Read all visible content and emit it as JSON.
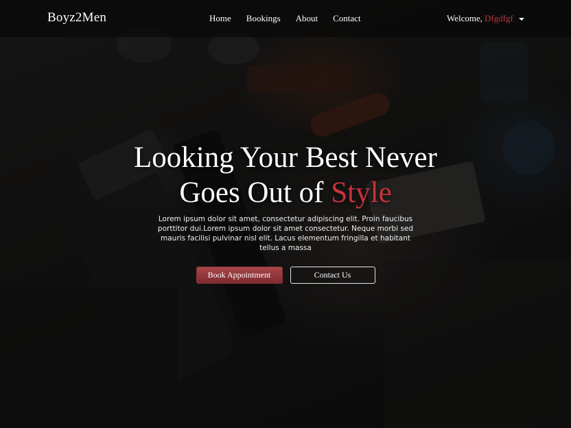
{
  "navbar": {
    "brand": "Boyz2Men",
    "links": [
      "Home",
      "Bookings",
      "About",
      "Contact"
    ],
    "welcome_label": "Welcome,",
    "user_name": "Dfgdfgf"
  },
  "hero": {
    "title_line1": "Looking Your Best Never",
    "title_line2_prefix": "Goes Out of ",
    "title_line2_accent": "Style",
    "description": "Lorem ipsum dolor sit amet, consectetur adipiscing elit. Proin faucibus porttitor dui.Lorem ipsum dolor sit amet consectetur. Neque morbi sed mauris facilisi pulvinar nisl elit. Lacus elementum fringilla et habitant tellus a massa",
    "primary_button": "Book Appointment",
    "secondary_button": "Contact Us"
  },
  "colors": {
    "accent": "#c8333b",
    "primary_button": "#8f3438",
    "navbar_bg": "#080808"
  }
}
